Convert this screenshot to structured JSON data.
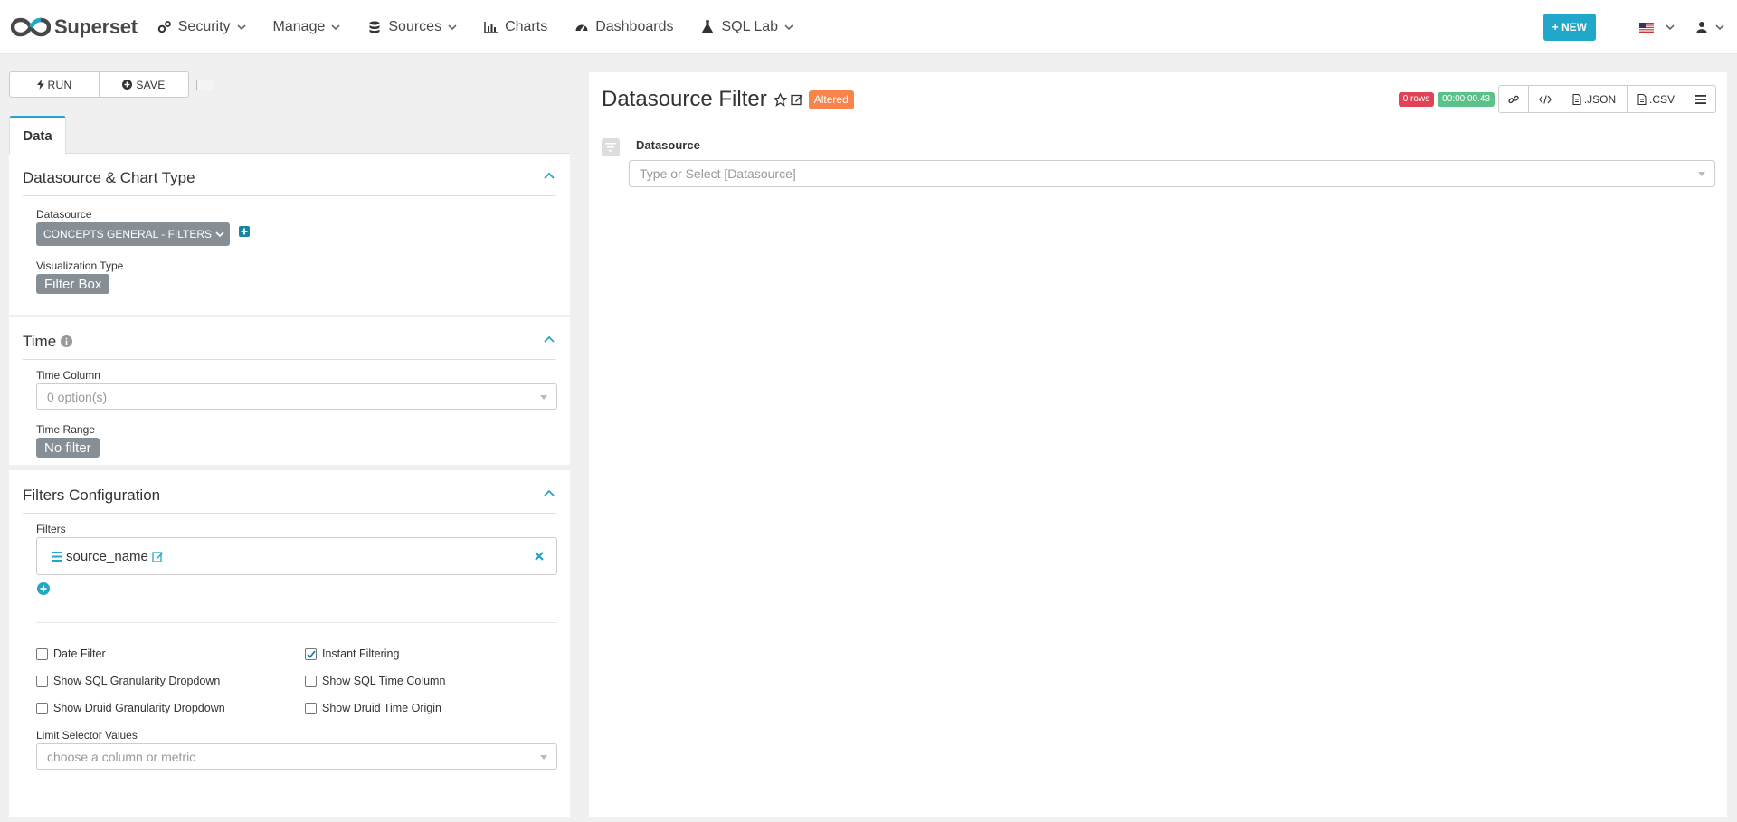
{
  "navbar": {
    "brand": "Superset",
    "items": [
      {
        "label": "Security",
        "icon": "gears-icon",
        "dropdown": true
      },
      {
        "label": "Manage",
        "icon": "",
        "dropdown": true
      },
      {
        "label": "Sources",
        "icon": "database-icon",
        "dropdown": true
      },
      {
        "label": "Charts",
        "icon": "bar-chart-icon",
        "dropdown": false
      },
      {
        "label": "Dashboards",
        "icon": "dashboard-icon",
        "dropdown": false
      },
      {
        "label": "SQL Lab",
        "icon": "flask-icon",
        "dropdown": true
      }
    ],
    "new_button": "+ NEW"
  },
  "toolbar": {
    "run_label": "RUN",
    "save_label": "SAVE"
  },
  "tabs": [
    "Data"
  ],
  "sections": {
    "datasource": {
      "title": "Datasource & Chart Type",
      "datasource_label": "Datasource",
      "datasource_value": "CONCEPTS GENERAL - FILTERS",
      "viz_label": "Visualization Type",
      "viz_value": "Filter Box"
    },
    "time": {
      "title": "Time",
      "time_column_label": "Time Column",
      "time_column_placeholder": "0 option(s)",
      "time_range_label": "Time Range",
      "time_range_value": "No filter"
    },
    "filters": {
      "title": "Filters Configuration",
      "filters_label": "Filters",
      "filter_item": "source_name",
      "checkboxes": [
        {
          "label": "Date Filter",
          "checked": false
        },
        {
          "label": "Instant Filtering",
          "checked": true
        },
        {
          "label": "Show SQL Granularity Dropdown",
          "checked": false
        },
        {
          "label": "Show SQL Time Column",
          "checked": false
        },
        {
          "label": "Show Druid Granularity Dropdown",
          "checked": false
        },
        {
          "label": "Show Druid Time Origin",
          "checked": false
        }
      ],
      "limit_label": "Limit Selector Values",
      "limit_placeholder": "choose a column or metric"
    }
  },
  "chart": {
    "title": "Datasource Filter",
    "altered": "Altered",
    "rows_badge": "0 rows",
    "time_badge": "00:00:00.43",
    "json_label": ".JSON",
    "csv_label": ".CSV",
    "widget_label": "Datasource",
    "widget_placeholder": "Type or Select [Datasource]"
  },
  "colors": {
    "accent": "#20a7c9",
    "altered": "#f9834c",
    "rows_badge": "#e04355",
    "time_badge": "#5ac189",
    "pill": "#868e96"
  }
}
